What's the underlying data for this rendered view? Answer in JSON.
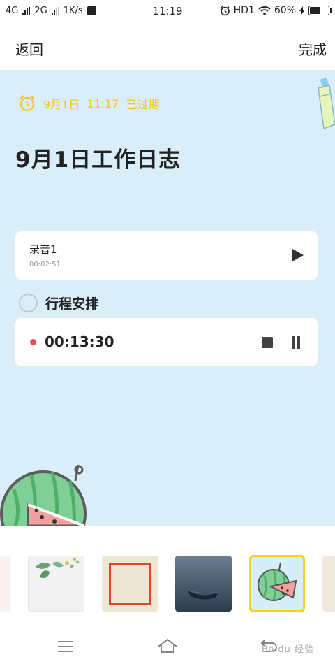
{
  "status_bar": {
    "network1": "4G",
    "network2": "2G",
    "speed": "1K/s",
    "time": "11:19",
    "hd": "HD1",
    "battery_text": "60%",
    "battery_level": 0.6
  },
  "nav": {
    "back_label": "返回",
    "done_label": "完成"
  },
  "note": {
    "reminder_date": "9月1日",
    "reminder_time": "11:17",
    "reminder_status": "已过期",
    "title": "9月1日工作日志",
    "recording": {
      "name": "录音1",
      "duration": "00:02:51"
    },
    "todo_label": "行程安排",
    "live_recording_time": "00:13:30"
  },
  "templates": {
    "selected_index": 4,
    "items": [
      "pink-floral",
      "green-leaves",
      "red-frame",
      "boat-lake",
      "watermelon",
      "beige"
    ]
  },
  "watermark": "Baidu 经验",
  "colors": {
    "note_background": "#d9eef9",
    "reminder": "#f5c518",
    "record_dot": "#e84c4c",
    "selected_border": "#f5d21f"
  }
}
